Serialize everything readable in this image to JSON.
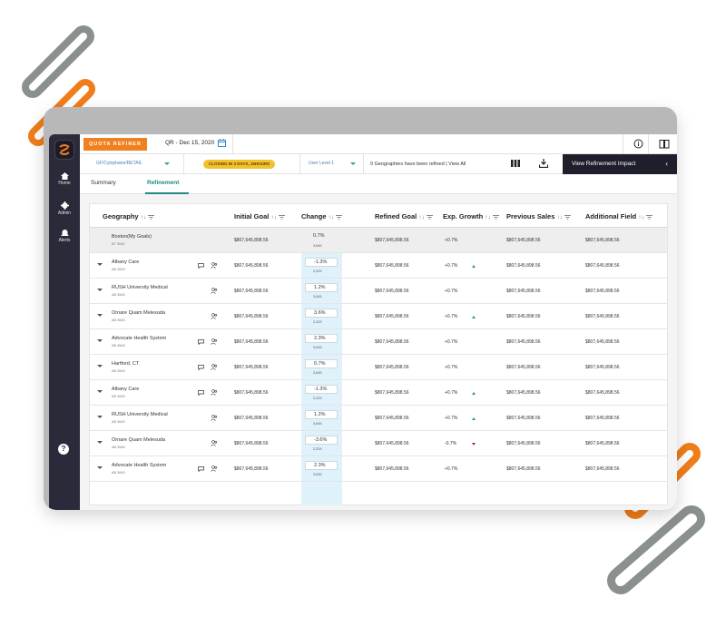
{
  "colors": {
    "accent": "#f08020",
    "sidebar": "#2b2a3a",
    "teal": "#1f8a84",
    "badge": "#f2c12e",
    "highlight": "#dff1fb"
  },
  "sidebar": {
    "items": [
      {
        "label": "Home",
        "icon": "home-icon"
      },
      {
        "label": "Admin",
        "icon": "gear-icon"
      },
      {
        "label": "Alerts",
        "icon": "bell-icon"
      }
    ],
    "help": "?"
  },
  "topbar": {
    "brand": "QUOTA REFINER",
    "period": "QR - Dec 15, 2020"
  },
  "filterbar": {
    "product": "GF/Cylophane/RETAIL",
    "closing": "CLOSING IN 3 DAYS, 15HOURS",
    "user_level": "User Level 1",
    "refined": "0 Geographies have been refined",
    "view_all": "View All",
    "impact_label": "View Refinement Impact"
  },
  "tabs": [
    {
      "label": "Summary"
    },
    {
      "label": "Refinement"
    }
  ],
  "table": {
    "columns": [
      {
        "label": "Geography",
        "sort": "↑↓"
      },
      {
        "label": "Initial Goal",
        "sort": "↑↓"
      },
      {
        "label": "Change",
        "sort": "↑↓"
      },
      {
        "label": "Refined Goal",
        "sort": "↑↓"
      },
      {
        "label": "Exp. Growth",
        "sort": "↑↓"
      },
      {
        "label": "Previous Sales",
        "sort": "↑↓"
      },
      {
        "label": "Additional Field",
        "sort": "↑↓"
      }
    ],
    "rows": [
      {
        "name": "Boston(My Goals)",
        "code": "BT 3645",
        "initial": "$807,645,898.56",
        "change": "0.7%",
        "change_sub": "3,645",
        "refined": "$807,645,898.56",
        "growth": "+0.7%",
        "trend": "",
        "prev": "$807,645,898.56",
        "additional": "$807,645,898.56"
      },
      {
        "name": "Albany Care",
        "code": "AB 3645",
        "initial": "$807,645,898.56",
        "change": "-1.3%",
        "change_sub": "2,229",
        "refined": "$807,645,898.56",
        "growth": "+0.7%",
        "trend": "up",
        "prev": "$807,645,898.56",
        "additional": "$807,645,898.56"
      },
      {
        "name": "RUSH University Medical",
        "code": "AB 3645",
        "initial": "$807,645,898.56",
        "change": "1.2%",
        "change_sub": "3,645",
        "refined": "$807,645,898.56",
        "growth": "+0.7%",
        "trend": "",
        "prev": "$807,645,898.56",
        "additional": "$807,645,898.56"
      },
      {
        "name": "Ornare Quam Melesuda",
        "code": "AB 3645",
        "initial": "$807,645,898.56",
        "change": "3.6%",
        "change_sub": "2,229",
        "refined": "$807,645,898.56",
        "growth": "+0.7%",
        "trend": "up",
        "prev": "$807,645,898.56",
        "additional": "$807,645,898.56"
      },
      {
        "name": "Advocate Health System",
        "code": "AB 3645",
        "initial": "$807,645,898.56",
        "change": "2.3%",
        "change_sub": "3,645",
        "refined": "$807,645,898.56",
        "growth": "+0.7%",
        "trend": "",
        "prev": "$807,645,898.56",
        "additional": "$807,645,898.56"
      },
      {
        "name": "Hartford, CT",
        "code": "AB 3645",
        "initial": "$807,645,898.56",
        "change": "0.7%",
        "change_sub": "3,645",
        "refined": "$807,645,898.56",
        "growth": "+0.7%",
        "trend": "",
        "prev": "$807,645,898.56",
        "additional": "$807,645,898.56"
      },
      {
        "name": "Albany Care",
        "code": "AB 3645",
        "initial": "$807,645,898.56",
        "change": "-1.3%",
        "change_sub": "2,229",
        "refined": "$807,645,898.56",
        "growth": "+0.7%",
        "trend": "up",
        "prev": "$807,645,898.56",
        "additional": "$807,645,898.56"
      },
      {
        "name": "RUSH University Medical",
        "code": "AB 3645",
        "initial": "$807,645,898.56",
        "change": "1.2%",
        "change_sub": "3,645",
        "refined": "$807,645,898.56",
        "growth": "+0.7%",
        "trend": "up",
        "prev": "$807,645,898.56",
        "additional": "$807,645,898.56"
      },
      {
        "name": "Ornare Quam Melesuda",
        "code": "AB 3645",
        "initial": "$807,645,898.56",
        "change": "-3.6%",
        "change_sub": "2,229",
        "refined": "$807,645,898.56",
        "growth": "-0.7%",
        "trend": "down",
        "prev": "$807,645,898.56",
        "additional": "$807,645,898.56"
      },
      {
        "name": "Advocate Health System",
        "code": "AB 3645",
        "initial": "$807,645,898.56",
        "change": "2.3%",
        "change_sub": "3,645",
        "refined": "$807,645,898.56",
        "growth": "+0.7%",
        "trend": "",
        "prev": "$807,645,898.56",
        "additional": "$807,645,898.56"
      }
    ]
  }
}
